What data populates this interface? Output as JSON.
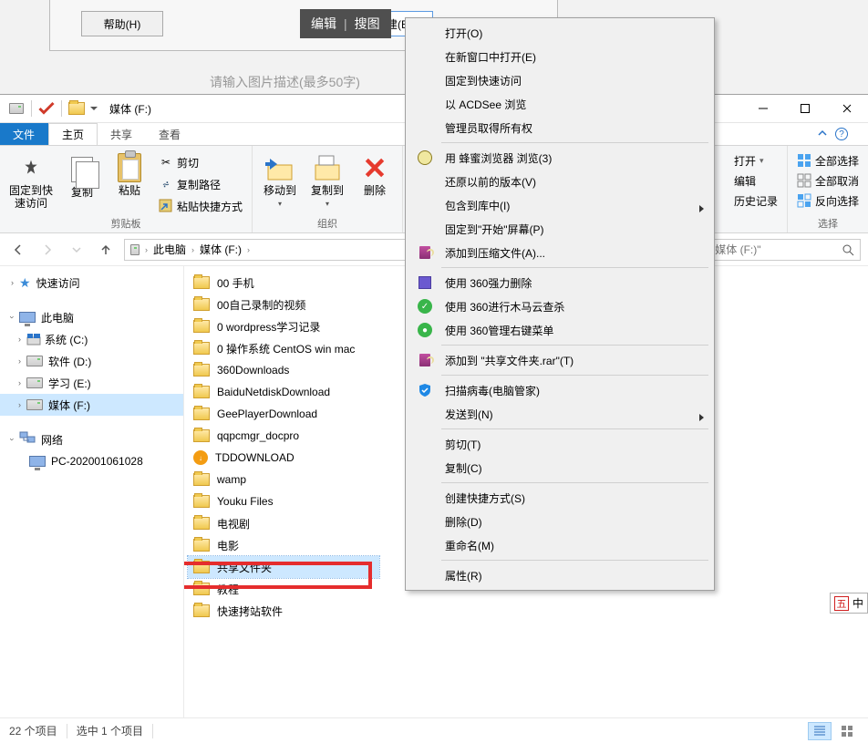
{
  "dialog": {
    "help": "帮助(H)",
    "edit": "编辑",
    "search": "搜图",
    "create": "创建(E",
    "caption_hint": "请输入图片描述(最多50字)"
  },
  "window": {
    "title": "媒体 (F:)",
    "min": "–",
    "max": "☐",
    "close": "✕"
  },
  "tabs": {
    "file": "文件",
    "home": "主页",
    "share": "共享",
    "view": "查看"
  },
  "ribbon": {
    "pin": "固定到快速访问",
    "copy": "复制",
    "paste": "粘贴",
    "cut": "剪切",
    "copy_path": "复制路径",
    "paste_shortcut": "粘贴快捷方式",
    "group_clipboard": "剪贴板",
    "move_to": "移动到",
    "copy_to": "复制到",
    "delete": "删除",
    "group_organize": "组织",
    "open": "打开",
    "open_dd": "▾",
    "edit": "编辑",
    "history": "历史记录",
    "select_all": "全部选择",
    "select_none": "全部取消",
    "invert": "反向选择",
    "group_select": "选择"
  },
  "breadcrumb": {
    "pc": "此电脑",
    "drive": "媒体 (F:)"
  },
  "search": {
    "placeholder": "搜索\"媒体 (F:)\""
  },
  "tree": {
    "quick": "快速访问",
    "pc": "此电脑",
    "c": "系统 (C:)",
    "d": "软件 (D:)",
    "e": "学习 (E:)",
    "f": "媒体 (F:)",
    "network": "网络",
    "pc_node": "PC-202001061028"
  },
  "files": [
    "00 手机",
    "00自己录制的视频",
    "0 wordpress学习记录",
    "0 操作系统 CentOS win mac",
    "360Downloads",
    "BaiduNetdiskDownload",
    "GeePlayerDownload",
    "qqpcmgr_docpro",
    "TDDOWNLOAD",
    "wamp",
    "Youku Files",
    "电视剧",
    "电影",
    "共享文件夹",
    "教程",
    "快速拷站软件"
  ],
  "status": {
    "count": "22 个项目",
    "selected": "选中 1 个项目"
  },
  "context": {
    "open": "打开(O)",
    "open_new": "在新窗口中打开(E)",
    "pin_quick": "固定到快速访问",
    "acdsee": "以 ACDSee 浏览",
    "admin_own": "管理员取得所有权",
    "honey": "用 蜂蜜浏览器 浏览(3)",
    "restore": "还原以前的版本(V)",
    "include_lib": "包含到库中(I)",
    "pin_start": "固定到\"开始\"屏幕(P)",
    "rar_add": "添加到压缩文件(A)...",
    "del360": "使用 360强力删除",
    "trojan360": "使用 360进行木马云查杀",
    "menu360": "使用 360管理右键菜单",
    "rar_named": "添加到 \"共享文件夹.rar\"(T)",
    "scan_virus": "扫描病毒(电脑管家)",
    "send_to": "发送到(N)",
    "cut": "剪切(T)",
    "copy": "复制(C)",
    "shortcut": "创建快捷方式(S)",
    "delete": "删除(D)",
    "rename": "重命名(M)",
    "properties": "属性(R)"
  },
  "ime": {
    "badge": "五",
    "text": "中"
  }
}
